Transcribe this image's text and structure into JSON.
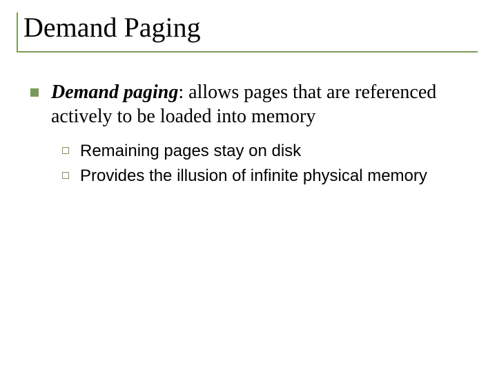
{
  "title": "Demand Paging",
  "main": {
    "term": "Demand paging",
    "definition": ":  allows pages that are referenced actively to be loaded into memory",
    "subpoints": [
      "Remaining pages stay on disk",
      "Provides the illusion of infinite physical memory"
    ]
  }
}
